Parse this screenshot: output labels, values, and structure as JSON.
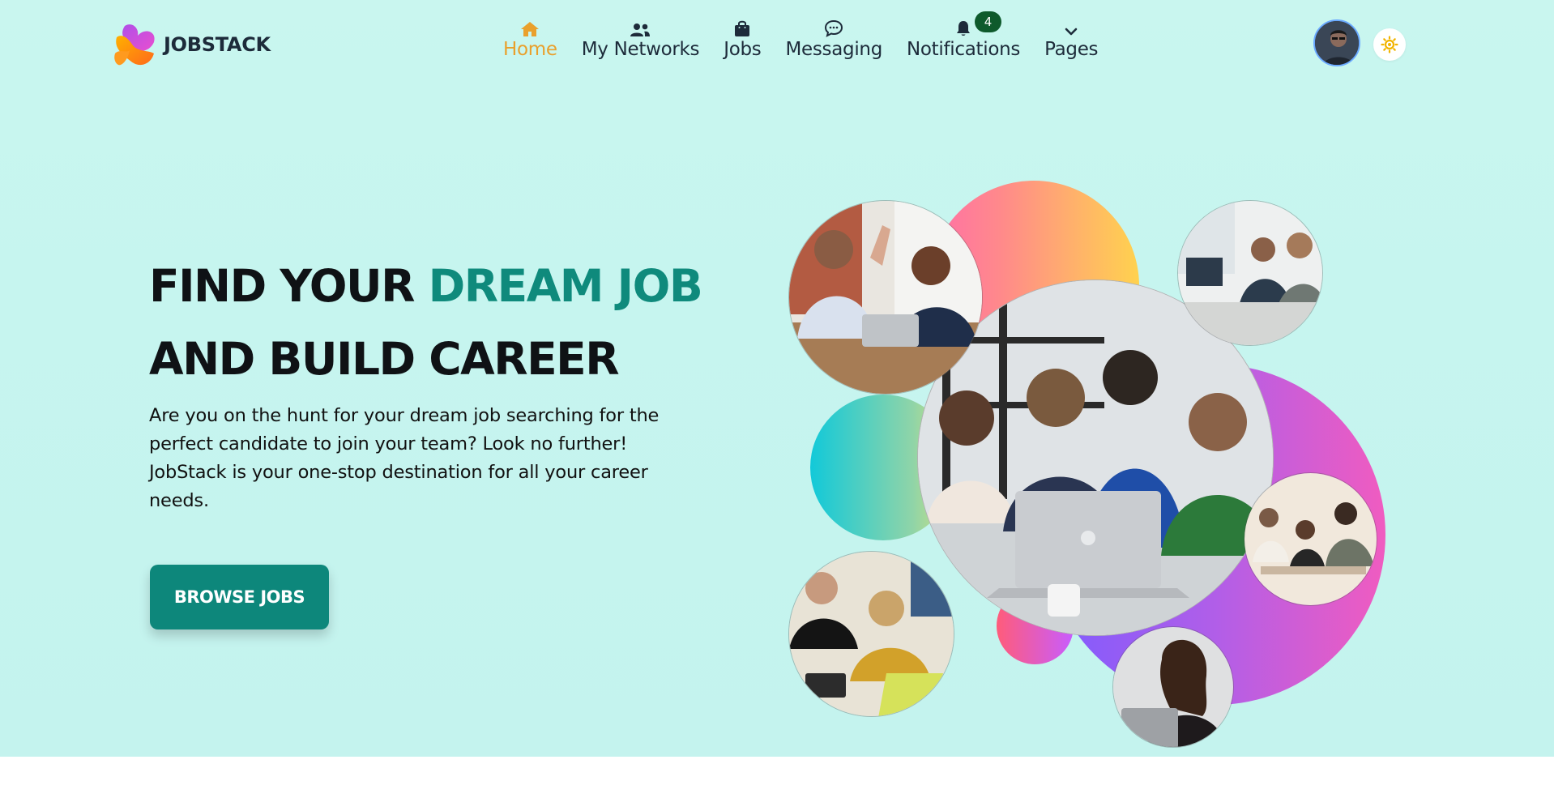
{
  "brand": {
    "name": "JOBSTACK"
  },
  "nav": {
    "items": [
      {
        "label": "Home",
        "icon": "home-icon",
        "active": true
      },
      {
        "label": "My Networks",
        "icon": "users-icon",
        "active": false
      },
      {
        "label": "Jobs",
        "icon": "briefcase-bag-icon",
        "active": false
      },
      {
        "label": "Messaging",
        "icon": "chat-bubble-icon",
        "active": false
      },
      {
        "label": "Notifications",
        "icon": "bell-icon",
        "active": false,
        "badge": "4"
      },
      {
        "label": "Pages",
        "icon": "chevron-down-icon",
        "active": false
      }
    ]
  },
  "header": {
    "avatar": "user-avatar",
    "theme_toggle": "sun-icon"
  },
  "hero": {
    "headline_line1_plain": "FIND YOUR ",
    "headline_line1_accent": "DREAM JOB",
    "headline_line2": "AND BUILD CAREER",
    "description": "Are you on the hunt for your dream job searching for the perfect candidate to join your team? Look no further! JobStack is your one-stop destination for all your career needs.",
    "cta_label": "BROWSE JOBS"
  },
  "colors": {
    "accent_teal": "#0f8a7c",
    "active_nav": "#e9a02c",
    "button_bg": "#0d877b",
    "badge_bg": "#0e5a2c",
    "hero_bg": "#c6f5ef"
  }
}
